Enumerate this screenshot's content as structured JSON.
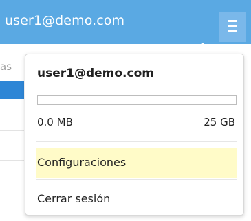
{
  "header": {
    "user_email": "user1@demo.com",
    "menu_icon": "hamburger-menu-icon"
  },
  "background": {
    "fragment_text": "as"
  },
  "account_menu": {
    "email": "user1@demo.com",
    "storage": {
      "used_label": "0.0 MB",
      "total_label": "25 GB",
      "used_fraction": 0.0
    },
    "items": [
      {
        "label": "Configuraciones",
        "highlighted": true
      },
      {
        "label": "Cerrar sesión",
        "highlighted": false
      }
    ]
  },
  "colors": {
    "header_bg": "#5aa9e3",
    "menu_button_bg": "#7ab8ea",
    "highlight_bg": "#fffbc8",
    "accent": "#2e86d6"
  }
}
